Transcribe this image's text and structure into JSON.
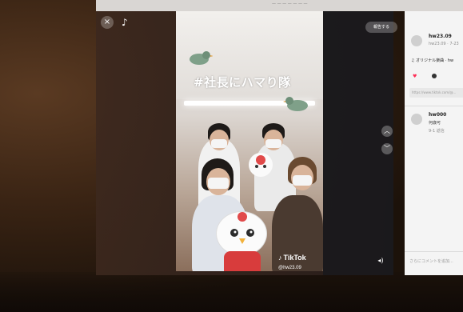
{
  "top_strip": {
    "text": "— — — — — — —"
  },
  "player": {
    "close_glyph": "×",
    "logo_glyph": "♪",
    "report_label": "報告する",
    "up_glyph": "︿",
    "down_glyph": "﹀",
    "volume_glyph": "◂)"
  },
  "video": {
    "title": "#社長にハマり隊",
    "watermark_brand": "TikTok",
    "watermark_handle": "@hw23.09",
    "watermark_glyph": "♪"
  },
  "panel": {
    "author_name": "hw23.09",
    "author_sub": "hw23.09 · 7-23",
    "music": "♫ オリジナル楽曲 · hw",
    "like_count": "",
    "comment_count": "",
    "link_text": "https://www.tiktok.com/@...",
    "commenter_name": "hw000",
    "comment_text": "何歳可",
    "comment_meta": "9-1 返信",
    "input_placeholder": "さらにコメントを追加..."
  },
  "colors": {
    "accent": "#fe2c55",
    "panel_bg": "#f4f4f4",
    "overlay_bg": "#2a2a2c"
  }
}
